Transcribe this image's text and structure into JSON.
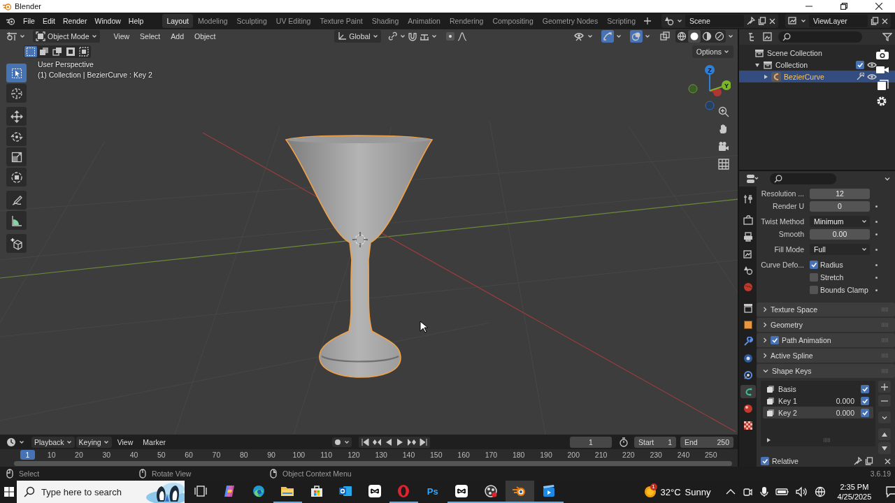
{
  "window": {
    "title": "Blender"
  },
  "menu": [
    "File",
    "Edit",
    "Render",
    "Window",
    "Help"
  ],
  "workspaces": [
    {
      "label": "Layout",
      "selected": true
    },
    {
      "label": "Modeling",
      "selected": false
    },
    {
      "label": "Sculpting",
      "selected": false
    },
    {
      "label": "UV Editing",
      "selected": false
    },
    {
      "label": "Texture Paint",
      "selected": false
    },
    {
      "label": "Shading",
      "selected": false
    },
    {
      "label": "Animation",
      "selected": false
    },
    {
      "label": "Rendering",
      "selected": false
    },
    {
      "label": "Compositing",
      "selected": false
    },
    {
      "label": "Geometry Nodes",
      "selected": false
    },
    {
      "label": "Scripting",
      "selected": false
    }
  ],
  "scene": {
    "name": "Scene"
  },
  "view_layer": {
    "name": "ViewLayer"
  },
  "viewport": {
    "mode": "Object Mode",
    "menus": [
      "View",
      "Select",
      "Add",
      "Object"
    ],
    "orientation": "Global",
    "select_modes": [
      {
        "selected": true
      },
      {
        "selected": false
      },
      {
        "selected": false
      },
      {
        "selected": false
      },
      {
        "selected": false
      }
    ],
    "shading": [
      {
        "kind": "wireframe",
        "selected": false
      },
      {
        "kind": "solid",
        "selected": true
      },
      {
        "kind": "material",
        "selected": false
      },
      {
        "kind": "rendered",
        "selected": false
      }
    ],
    "options": "Options",
    "view_name": "User Perspective",
    "object_info": "(1) Collection | BezierCurve : Key 2",
    "tools": [
      {
        "kind": "select",
        "selected": true
      },
      {
        "kind": "cursor",
        "selected": false
      },
      {
        "kind": "move",
        "selected": false
      },
      {
        "kind": "rotate",
        "selected": false
      },
      {
        "kind": "scale",
        "selected": false
      },
      {
        "kind": "transform",
        "selected": false
      },
      {
        "kind": "annotate",
        "selected": false
      },
      {
        "kind": "measure",
        "selected": false
      },
      {
        "kind": "add-cube",
        "selected": false
      }
    ],
    "gizmo": {
      "z": "Z",
      "y": "Y"
    }
  },
  "outliner": {
    "tree": [
      {
        "label": "Scene Collection",
        "kind": "scene",
        "selected": false,
        "children": [
          {
            "label": "Collection",
            "kind": "collection",
            "expanded": true,
            "checked": true,
            "selected": false,
            "children": [
              {
                "label": "BezierCurve",
                "kind": "curve",
                "expanded": false,
                "selected": true
              }
            ]
          }
        ]
      }
    ]
  },
  "properties": {
    "tabs": [
      {
        "kind": "tool",
        "selected": false
      },
      {
        "kind": "render",
        "selected": false
      },
      {
        "kind": "output",
        "selected": false
      },
      {
        "kind": "view",
        "selected": false
      },
      {
        "kind": "scene",
        "selected": false
      },
      {
        "kind": "world",
        "selected": false
      },
      {
        "kind": "collection",
        "selected": false
      },
      {
        "kind": "object",
        "selected": false
      },
      {
        "kind": "modifiers",
        "selected": false
      },
      {
        "kind": "physics",
        "selected": false
      },
      {
        "kind": "constraints",
        "selected": false
      },
      {
        "kind": "data",
        "selected": true
      },
      {
        "kind": "material",
        "selected": false
      },
      {
        "kind": "texture",
        "selected": false
      }
    ],
    "row_groups": [
      [
        {
          "kind": "number",
          "label": "Resolution ...",
          "value": "12",
          "dot": false
        },
        {
          "kind": "number",
          "label": "Render U",
          "value": "0",
          "dot": true
        }
      ],
      [
        {
          "kind": "dropdown",
          "label": "Twist Method",
          "value": "Minimum",
          "dot": true
        },
        {
          "kind": "number",
          "label": "Smooth",
          "value": "0.00",
          "dot": true
        }
      ],
      [
        {
          "kind": "dropdown",
          "label": "Fill Mode",
          "value": "Full",
          "dot": true
        }
      ],
      [
        {
          "kind": "checkbox",
          "label": "Curve Defo...",
          "text": "Radius",
          "checked": true,
          "dot": true
        },
        {
          "kind": "checkbox",
          "text": "Stretch",
          "checked": false,
          "dot": true
        },
        {
          "kind": "checkbox",
          "text": "Bounds Clamp",
          "checked": false,
          "dot": true
        }
      ]
    ],
    "panels": [
      {
        "title": "Texture Space",
        "expanded": false
      },
      {
        "title": "Geometry",
        "expanded": false
      },
      {
        "title": "Path Animation",
        "expanded": false,
        "checked": true
      },
      {
        "title": "Active Spline",
        "expanded": false
      },
      {
        "title": "Shape Keys",
        "expanded": true
      }
    ],
    "shape_keys": [
      {
        "name": "Basis",
        "checked": true,
        "selected": false
      },
      {
        "name": "Key 1",
        "value": "0.000",
        "checked": true,
        "selected": false
      },
      {
        "name": "Key 2",
        "value": "0.000",
        "checked": true,
        "selected": true
      }
    ],
    "relative": {
      "label": "Relative",
      "checked": true
    }
  },
  "timeline": {
    "auto_keying": false,
    "menus": [
      "Playback",
      "Keying",
      "View",
      "Marker"
    ],
    "frame": "1",
    "start_label": "Start",
    "start": "1",
    "end_label": "End",
    "end": "250",
    "playhead": "1",
    "ticks": [
      "10",
      "20",
      "30",
      "40",
      "50",
      "60",
      "70",
      "80",
      "90",
      "100",
      "110",
      "120",
      "130",
      "140",
      "150",
      "160",
      "170",
      "180",
      "190",
      "200",
      "210",
      "220",
      "230",
      "240",
      "250"
    ]
  },
  "status_bar": {
    "hints": [
      {
        "kind": "left",
        "text": "Select"
      },
      {
        "kind": "middle",
        "text": "Rotate View"
      },
      {
        "kind": "right",
        "text": "Object Context Menu"
      }
    ],
    "version": "3.6.19"
  },
  "taskbar": {
    "search": {
      "placeholder": "Type here to search"
    },
    "apps": [
      {
        "kind": "taskview",
        "running": false,
        "active": false
      },
      {
        "kind": "copilot",
        "running": false,
        "active": false
      },
      {
        "kind": "edge",
        "running": false,
        "active": false
      },
      {
        "kind": "explorer",
        "running": true,
        "active": false
      },
      {
        "kind": "store",
        "running": false,
        "active": false
      },
      {
        "kind": "outlook",
        "running": false,
        "active": false
      },
      {
        "kind": "capcut",
        "running": false,
        "active": false
      },
      {
        "kind": "opera",
        "running": true,
        "active": false
      },
      {
        "kind": "photoshop",
        "label": "Ps",
        "running": false,
        "active": false
      },
      {
        "kind": "capcut",
        "running": true,
        "active": false
      },
      {
        "kind": "obs",
        "running": true,
        "active": false
      },
      {
        "kind": "blender",
        "running": true,
        "active": true
      },
      {
        "kind": "movie",
        "running": true,
        "active": false
      }
    ],
    "weather": {
      "badge": "1",
      "temp": "32°C",
      "condition": "Sunny"
    },
    "clock": {
      "time": "2:35 PM",
      "date": "4/25/2025"
    }
  }
}
